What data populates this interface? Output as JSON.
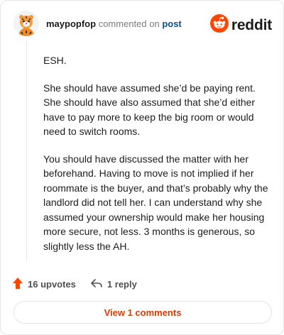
{
  "comment": {
    "username": "maypopfop",
    "commented_on_text": "commented on",
    "post_link": "post",
    "paragraphs": [
      "ESH.",
      "She should have assumed she’d be paying rent. She should have also assumed that she’d either have to pay more to keep the big room or would need to switch rooms.",
      "You should have discussed the matter with her beforehand. Having to move is not implied if her roommate is the buyer, and that’s probably why the landlord did not tell her. I can understand why she assumed your ownership would make her housing more secure, not less. 3 months is generous, so slightly less the AH."
    ]
  },
  "brand": {
    "name": "reddit",
    "icon": "reddit-snoo-icon",
    "color": "#ff4500"
  },
  "actions": {
    "upvotes_label": "16 upvotes",
    "upvote_icon": "upvote-arrow-icon",
    "upvote_color": "#ff4500",
    "reply_label": "1 reply",
    "reply_icon": "reply-arrow-icon"
  },
  "footer": {
    "view_comments_label": "View 1 comments",
    "accent_color": "#d93a00"
  }
}
